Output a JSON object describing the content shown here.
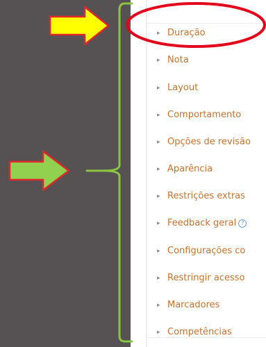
{
  "sections": [
    {
      "label": "Duração",
      "help": false
    },
    {
      "label": "Nota",
      "help": false
    },
    {
      "label": "Layout",
      "help": false
    },
    {
      "label": "Comportamento",
      "help": false
    },
    {
      "label": "Opções de revisão",
      "help": false
    },
    {
      "label": "Aparência",
      "help": false
    },
    {
      "label": "Restrições extras",
      "help": false
    },
    {
      "label": "Feedback geral",
      "help": true
    },
    {
      "label": "Configurações co",
      "help": false
    },
    {
      "label": "Restringir acesso",
      "help": false
    },
    {
      "label": "Marcadores",
      "help": false
    },
    {
      "label": "Competências",
      "help": false
    }
  ],
  "help_glyph": "?",
  "colors": {
    "link": "#c5722f",
    "dark_background": "#565254",
    "yellow_arrow": "#ffff00",
    "green_arrow": "#92d050",
    "arrow_outline": "#e0262b",
    "highlight_ellipse": "#e3001b",
    "bracket": "#8cc63f"
  }
}
